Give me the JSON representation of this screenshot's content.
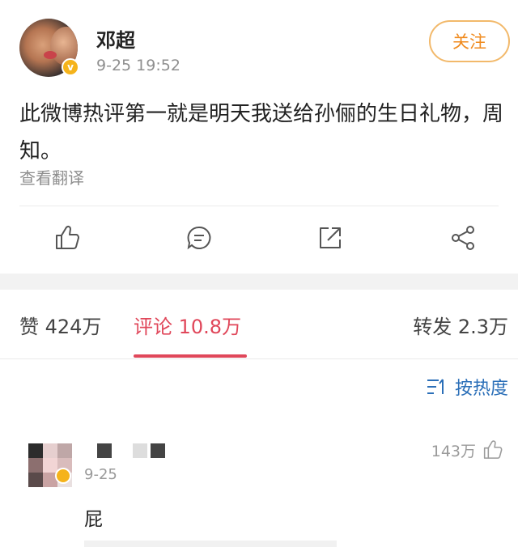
{
  "post": {
    "username": "邓超",
    "time": "9-25 19:52",
    "follow_label": "关注",
    "text": "此微博热评第一就是明天我送给孙俪的生日礼物，周知。",
    "translate_label": "查看翻译"
  },
  "actions": {
    "like_icon": "thumbs-up-icon",
    "comment_icon": "comment-icon",
    "repost_icon": "share-out-icon",
    "share_icon": "share-nodes-icon"
  },
  "tabs": {
    "likes": "赞 424万",
    "comments": "评论 10.8万",
    "reposts": "转发 2.3万"
  },
  "sort": {
    "label": "按热度",
    "icon": "sort-icon"
  },
  "comment": {
    "time": "9-25",
    "likes": "143万",
    "text": "屁"
  },
  "colors": {
    "accent_red": "#e0475a",
    "follow_orange": "#f08a1d",
    "link_blue": "#2b6fb8",
    "verified_gold": "#f5b31b"
  }
}
